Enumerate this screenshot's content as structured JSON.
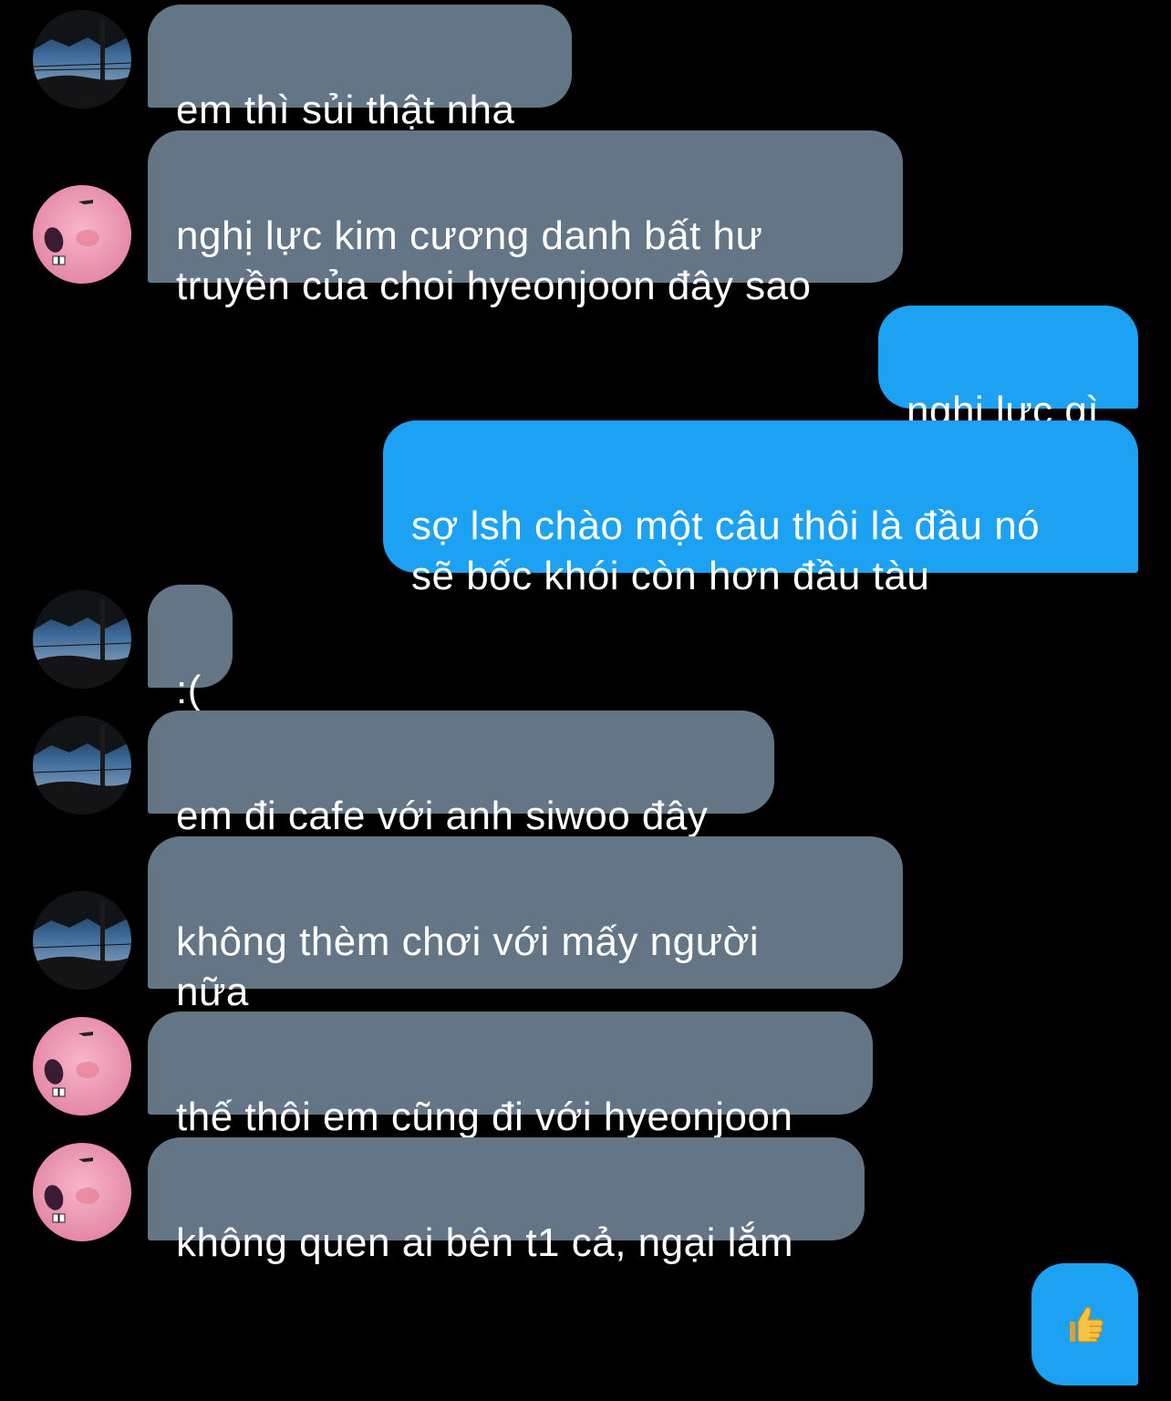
{
  "conversation": {
    "messages": [
      {
        "sender": "tree",
        "direction": "incoming",
        "text": "em thì sủi thật nha"
      },
      {
        "sender": "pink",
        "direction": "incoming",
        "text": "nghị lực kim cương danh bất hư\ntruyền của choi hyeonjoon đây sao"
      },
      {
        "sender": "me",
        "direction": "outgoing",
        "text": "nghị lực gì"
      },
      {
        "sender": "me",
        "direction": "outgoing",
        "text": "sợ lsh chào một câu thôi là đầu nó\nsẽ bốc khói còn hơn đầu tàu"
      },
      {
        "sender": "tree",
        "direction": "incoming",
        "text": ":("
      },
      {
        "sender": "tree",
        "direction": "incoming",
        "text": "em đi cafe với anh siwoo đây"
      },
      {
        "sender": "tree",
        "direction": "incoming",
        "text": "không thèm chơi với mấy người\nnữa"
      },
      {
        "sender": "pink",
        "direction": "incoming",
        "text": "thế thôi em cũng đi với hyeonjoon"
      },
      {
        "sender": "pink",
        "direction": "incoming",
        "text": "không quen ai bên t1 cả, ngại lắm"
      },
      {
        "sender": "me",
        "direction": "outgoing",
        "emoji": "thumbs-up-icon"
      }
    ]
  },
  "colors": {
    "background": "#000000",
    "incoming_bubble": "#647586",
    "outgoing_bubble": "#1da1f2",
    "text": "#ffffff"
  }
}
